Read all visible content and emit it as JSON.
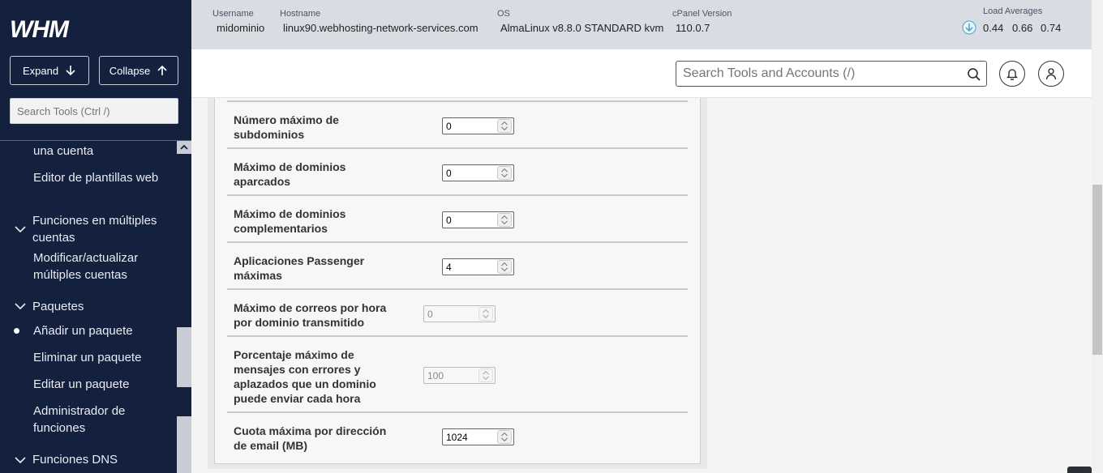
{
  "app": {
    "logo_text": "WHM"
  },
  "sidebar": {
    "expand_label": "Expand",
    "collapse_label": "Collapse",
    "search_placeholder": "Search Tools (Ctrl /)",
    "items": [
      {
        "label": "una cuenta",
        "type": "sub"
      },
      {
        "label": "Editor de plantillas web",
        "type": "sub"
      },
      {
        "label": "Funciones en múltiples cuentas",
        "type": "group"
      },
      {
        "label": "Modificar/actualizar múltiples cuentas",
        "type": "sub"
      },
      {
        "label": "Paquetes",
        "type": "group"
      },
      {
        "label": "Añadir un paquete",
        "type": "sub",
        "active": true
      },
      {
        "label": "Eliminar un paquete",
        "type": "sub"
      },
      {
        "label": "Editar un paquete",
        "type": "sub"
      },
      {
        "label": "Administrador de funciones",
        "type": "sub"
      },
      {
        "label": "Funciones DNS",
        "type": "group"
      }
    ]
  },
  "header": {
    "username_label": "Username",
    "username": "midominio",
    "hostname_label": "Hostname",
    "hostname": "linux90.webhosting-network-services.com",
    "os_label": "OS",
    "os": "AlmaLinux v8.8.0 STANDARD kvm",
    "cpanel_label": "cPanel Version",
    "cpanel_version": "110.0.7",
    "load_label": "Load Averages",
    "load": [
      "0.44",
      "0.66",
      "0.74"
    ]
  },
  "search": {
    "placeholder": "Search Tools and Accounts (/)"
  },
  "form": {
    "fields": [
      {
        "label": "Número máximo de subdominios",
        "value": "0",
        "disabled": false
      },
      {
        "label": "Máximo de dominios aparcados",
        "value": "0",
        "disabled": false
      },
      {
        "label": "Máximo de dominios complementarios",
        "value": "0",
        "disabled": false
      },
      {
        "label": "Aplicaciones Passenger máximas",
        "value": "4",
        "disabled": false
      },
      {
        "label": "Máximo de correos por hora por dominio transmitido",
        "value": "0",
        "disabled": true
      },
      {
        "label": "Porcentaje máximo de mensajes con errores y aplazados que un dominio puede enviar cada hora",
        "value": "100",
        "disabled": true
      },
      {
        "label": "Cuota máxima por dirección de email (MB)",
        "value": "1024",
        "disabled": false
      }
    ]
  },
  "colors": {
    "sidebar_bg": "#13213f",
    "topbar_bg": "#d9dde3",
    "panel_bg": "#f7f7f7"
  }
}
